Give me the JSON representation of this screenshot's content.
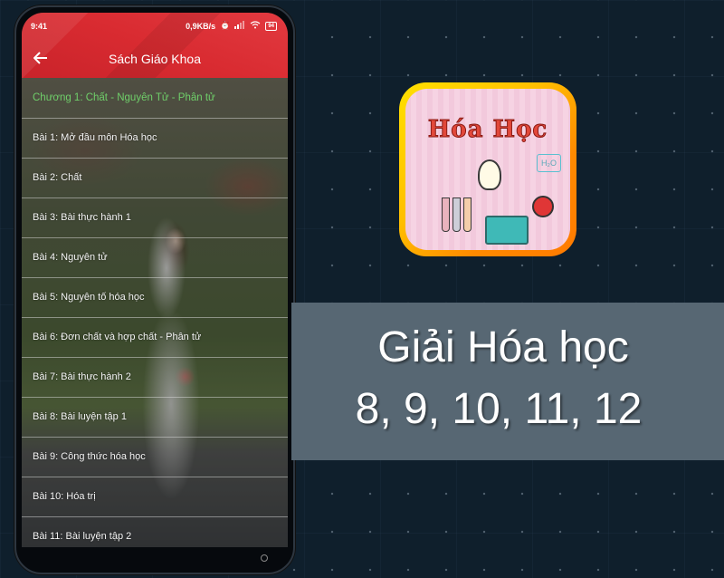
{
  "status_bar": {
    "time": "9:41",
    "network_speed": "0,9KB/s",
    "battery": "94"
  },
  "app_bar": {
    "back_icon": "arrow-left-icon",
    "title": "Sách Giáo Khoa"
  },
  "chapter": {
    "title": "Chương 1: Chất - Nguyên Tử - Phân tử",
    "color": "#6fcf6a"
  },
  "lessons": [
    {
      "label": "Bài 1: Mở đầu môn Hóa học"
    },
    {
      "label": "Bài 2: Chất"
    },
    {
      "label": "Bài 3: Bài thực hành 1"
    },
    {
      "label": "Bài 4: Nguyên tử"
    },
    {
      "label": "Bài 5: Nguyên tố hóa học"
    },
    {
      "label": "Bài 6: Đơn chất và hợp chất - Phân tử"
    },
    {
      "label": "Bài 7: Bài thực hành 2"
    },
    {
      "label": "Bài 8: Bài luyện tập 1"
    },
    {
      "label": "Bài 9: Công thức hóa học"
    },
    {
      "label": "Bài 10: Hóa trị"
    },
    {
      "label": "Bài 11: Bài luyện tập 2"
    }
  ],
  "app_icon": {
    "title": "Hóa Học",
    "formula": "H₂O"
  },
  "banner": {
    "line1": "Giải Hóa học",
    "line2": "8, 9, 10, 11, 12"
  },
  "colors": {
    "app_bar": "#d92b31",
    "banner_bg": "#576773",
    "page_bg": "#0f1f2c"
  }
}
